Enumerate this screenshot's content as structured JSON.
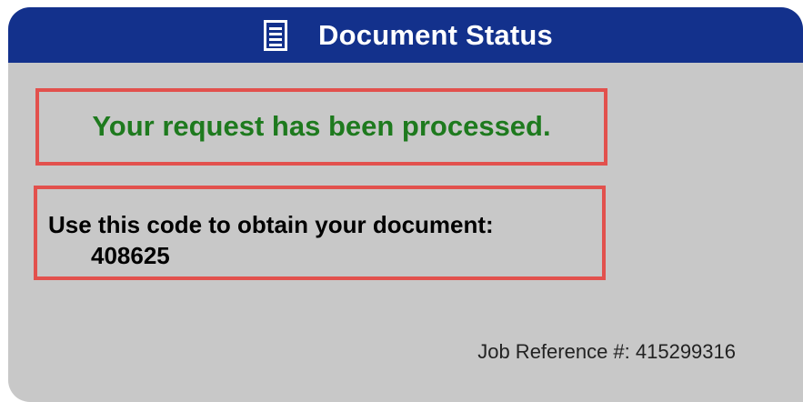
{
  "header": {
    "icon": "document-icon",
    "title": "Document Status"
  },
  "status": {
    "message": "Your request has been processed."
  },
  "code": {
    "label": "Use this code to obtain your document:",
    "value": "408625"
  },
  "job": {
    "reference_text": "Job Reference #: 415299316"
  },
  "colors": {
    "header_bg": "#13318c",
    "card_bg": "#c8c8c8",
    "highlight_border": "#e2514d",
    "success_text": "#1e7a1e"
  }
}
